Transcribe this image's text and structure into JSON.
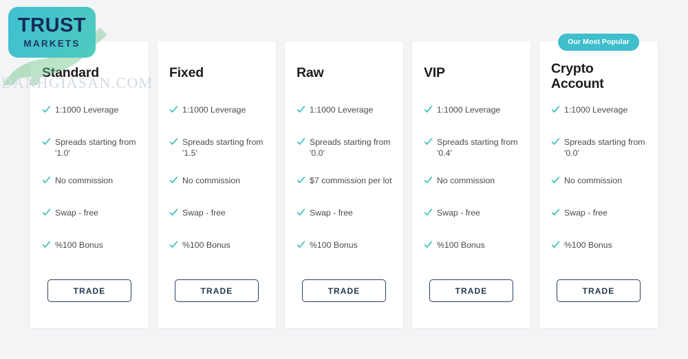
{
  "page": {
    "background_color": "#f3f4f6"
  },
  "branding": {
    "logo_top": "TRUST",
    "logo_sub": "MARKETS",
    "logo_bg_color": "#45c3c8",
    "logo_text_color": "#152a57",
    "watermark_text": "DANHGIASAN.COM",
    "watermark_color": "#d3dae3",
    "bull_color": "#6ec38a"
  },
  "theme": {
    "accent_color": "#3fbecc",
    "check_color": "#3ebfbd",
    "button_border_color": "#2b3e5c",
    "card_bg": "#ffffff",
    "title_color": "#1c1c1c",
    "feature_text_color": "#4a4a4a"
  },
  "trade_button_label": "TRADE",
  "plans": [
    {
      "name": "Standard",
      "badge": null,
      "features": [
        "1:1000 Leverage",
        "Spreads starting from '1.0'",
        "No commission",
        "Swap - free",
        "%100 Bonus"
      ],
      "cta": "TRADE"
    },
    {
      "name": "Fixed",
      "badge": null,
      "features": [
        "1:1000 Leverage",
        "Spreads starting from '1.5'",
        "No commission",
        "Swap - free",
        "%100 Bonus"
      ],
      "cta": "TRADE"
    },
    {
      "name": "Raw",
      "badge": null,
      "features": [
        "1:1000 Leverage",
        "Spreads starting from '0.0'",
        "$7 commission per lot",
        "Swap - free",
        "%100 Bonus"
      ],
      "cta": "TRADE"
    },
    {
      "name": "VIP",
      "badge": null,
      "features": [
        "1:1000 Leverage",
        "Spreads starting from '0.4'",
        "No commission",
        "Swap - free",
        "%100 Bonus"
      ],
      "cta": "TRADE"
    },
    {
      "name": "Crypto Account",
      "badge": "Our Most Popular",
      "features": [
        "1:1000 Leverage",
        "Spreads starting from '0.0'",
        "No commission",
        "Swap - free",
        "%100 Bonus"
      ],
      "cta": "TRADE"
    }
  ]
}
